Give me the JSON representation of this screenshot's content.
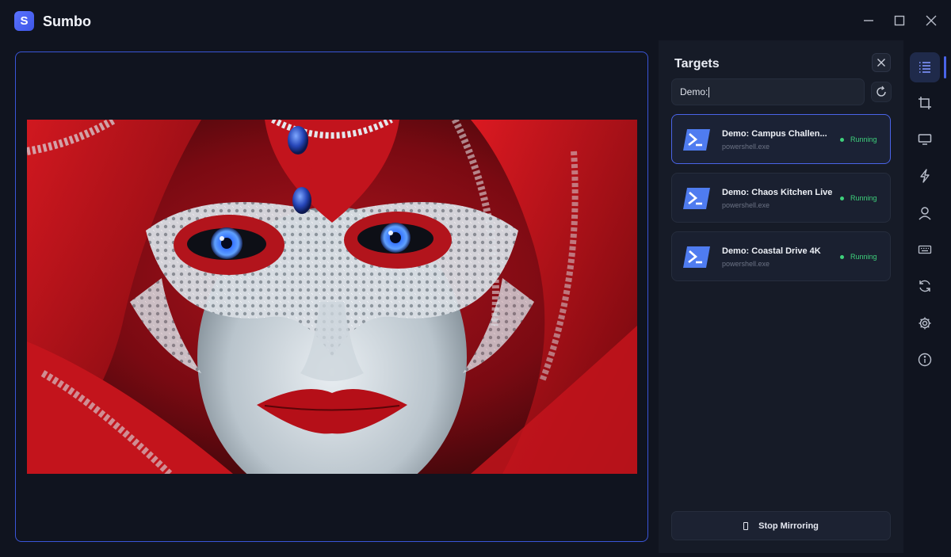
{
  "app": {
    "title": "Sumbo",
    "logo_letter": "S",
    "accent": "#4a64e8"
  },
  "window_controls": [
    "minimize-icon",
    "maximize-icon",
    "close-icon"
  ],
  "preview": {
    "image_alt": "Woman in ornate white and red Venetian lace mask with red hood and blue eyes"
  },
  "targets_panel": {
    "title": "Targets",
    "search": {
      "value": "Demo:",
      "placeholder": ""
    },
    "items": [
      {
        "title": "Demo: Campus  Challen...",
        "subtitle": "powershell.exe",
        "status": "Running",
        "active": true
      },
      {
        "title": "Demo: Chaos Kitchen Live",
        "subtitle": "powershell.exe",
        "status": "Running",
        "active": false
      },
      {
        "title": "Demo: Coastal Drive 4K",
        "subtitle": "powershell.exe",
        "status": "Running",
        "active": false
      }
    ],
    "stop_button_label": "Stop Mirroring",
    "status_color": "#3ed07b"
  },
  "rail": {
    "items": [
      {
        "icon": "list-icon",
        "active": true
      },
      {
        "icon": "crop-icon",
        "active": false
      },
      {
        "icon": "monitor-icon",
        "active": false
      },
      {
        "icon": "lightning-icon",
        "active": false
      },
      {
        "icon": "user-icon",
        "active": false
      },
      {
        "icon": "keyboard-icon",
        "active": false
      },
      {
        "icon": "sync-icon",
        "active": false
      },
      {
        "icon": "gear-icon",
        "active": false
      },
      {
        "icon": "info-icon",
        "active": false
      }
    ]
  }
}
